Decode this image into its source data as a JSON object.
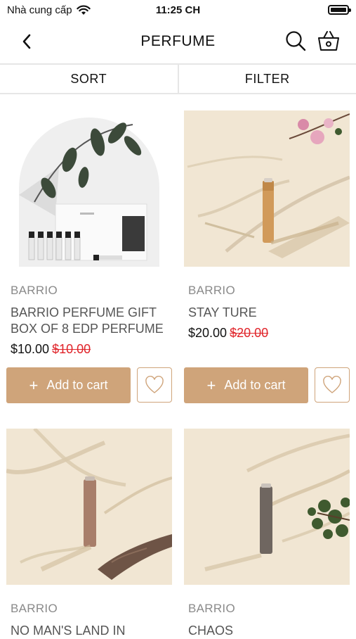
{
  "status_bar": {
    "carrier": "Nhà cung cấp",
    "time": "11:25 CH"
  },
  "header": {
    "title": "PERFUME"
  },
  "tabs": {
    "sort": "SORT",
    "filter": "FILTER"
  },
  "products": [
    {
      "brand": "BARRIO",
      "name": "BARRIO PERFUME GIFT BOX OF 8 EDP PERFUME",
      "price": "$10.00",
      "old_price": "$10.00",
      "add_label": "Add to cart"
    },
    {
      "brand": "BARRIO",
      "name": "STAY TURE",
      "price": "$20.00",
      "old_price": "$20.00",
      "add_label": "Add to cart"
    },
    {
      "brand": "BARRIO",
      "name": "NO MAN'S LAND IN"
    },
    {
      "brand": "BARRIO",
      "name": "CHAOS"
    }
  ],
  "icons": {
    "back": "chevron-left-icon",
    "search": "search-icon",
    "cart": "basket-icon",
    "wishlist": "heart-icon",
    "wifi": "wifi-icon",
    "battery": "battery-icon"
  },
  "colors": {
    "accent": "#cfa47a",
    "sale": "#e0242a"
  }
}
